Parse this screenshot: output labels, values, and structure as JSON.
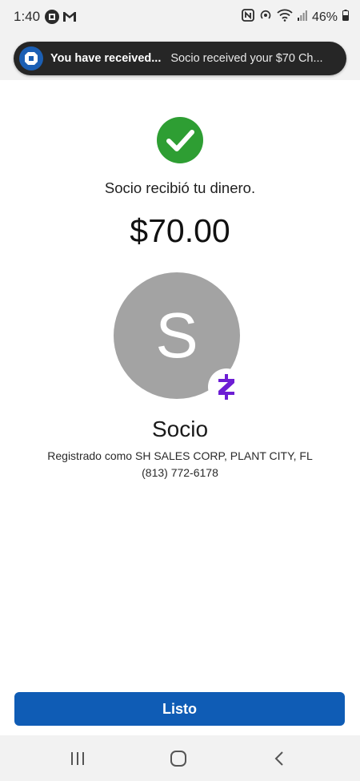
{
  "status_bar": {
    "time": "1:40",
    "battery_percent": "46%",
    "left_icons": [
      "chase-icon",
      "gmail-icon"
    ],
    "right_icons": [
      "nfc-icon",
      "hotspot-icon",
      "wifi-icon",
      "signal-icon",
      "battery-icon"
    ]
  },
  "notification": {
    "app_icon": "chase-icon",
    "app_icon_color": "#1b5fb4",
    "title": "You have received...",
    "body": "Socio received your $70 Ch..."
  },
  "confirmation": {
    "status_icon": "checkmark-icon",
    "status_color": "#2e9e33",
    "message": "Socio recibió tu dinero.",
    "amount": "$70.00"
  },
  "recipient": {
    "avatar_initial": "S",
    "avatar_color": "#a3a3a3",
    "badge_icon": "zelle-icon",
    "badge_color": "#6d1ed4",
    "name": "Socio",
    "registered_as": "Registrado como SH SALES CORP, PLANT CITY, FL",
    "phone": "(813) 772-6178"
  },
  "actions": {
    "done_label": "Listo",
    "done_color": "#0f5cb5"
  },
  "nav_bar": {
    "buttons": [
      "recent-apps-icon",
      "home-icon",
      "back-icon"
    ]
  }
}
